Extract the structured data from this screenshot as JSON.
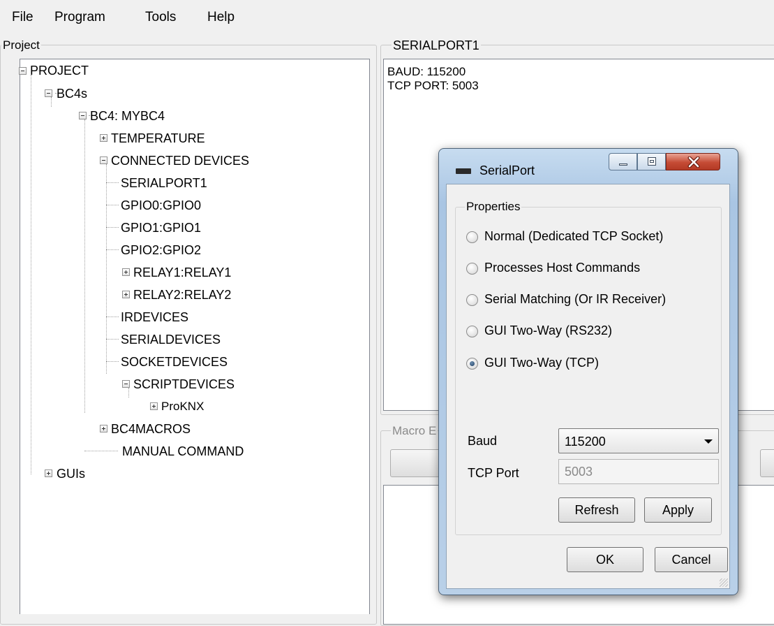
{
  "menu": {
    "file": "File",
    "program": "Program",
    "tools": "Tools",
    "help": "Help"
  },
  "project_panel": {
    "title": "Project",
    "tree": {
      "project": "PROJECT",
      "bc4s": "BC4s",
      "bc4": "BC4: MYBC4",
      "temperature": "TEMPERATURE",
      "connected_devices": "CONNECTED DEVICES",
      "serialport1": "SERIALPORT1",
      "gpio0": "GPIO0:GPIO0",
      "gpio1": "GPIO1:GPIO1",
      "gpio2": "GPIO2:GPIO2",
      "relay1": "RELAY1:RELAY1",
      "relay2": "RELAY2:RELAY2",
      "irdevices": "IRDEVICES",
      "serialdevices": "SERIALDEVICES",
      "socketdevices": "SOCKETDEVICES",
      "scriptdevices": "SCRIPTDEVICES",
      "proknx": "ProKNX",
      "bc4macros": "BC4MACROS",
      "manual_command": "MANUAL COMMAND",
      "guis": "GUIs"
    }
  },
  "details_panel": {
    "title": "SERIALPORT1",
    "baud_line": "BAUD: 115200",
    "tcp_line": "TCP PORT: 5003"
  },
  "macro_panel": {
    "title": "Macro E"
  },
  "dialog": {
    "title": "SerialPort",
    "icon": "serial-port-icon",
    "properties_title": "Properties",
    "options": [
      "Normal (Dedicated TCP Socket)",
      "Processes Host Commands",
      "Serial Matching (Or IR Receiver)",
      "GUI Two-Way (RS232)",
      "GUI Two-Way (TCP)"
    ],
    "selected_option": "GUI Two-Way (TCP)",
    "baud_label": "Baud",
    "baud_value": "115200",
    "tcp_port_label": "TCP Port",
    "tcp_port_value": "5003",
    "refresh_label": "Refresh",
    "apply_label": "Apply",
    "ok_label": "OK",
    "cancel_label": "Cancel",
    "close_color": "#c54b35"
  }
}
